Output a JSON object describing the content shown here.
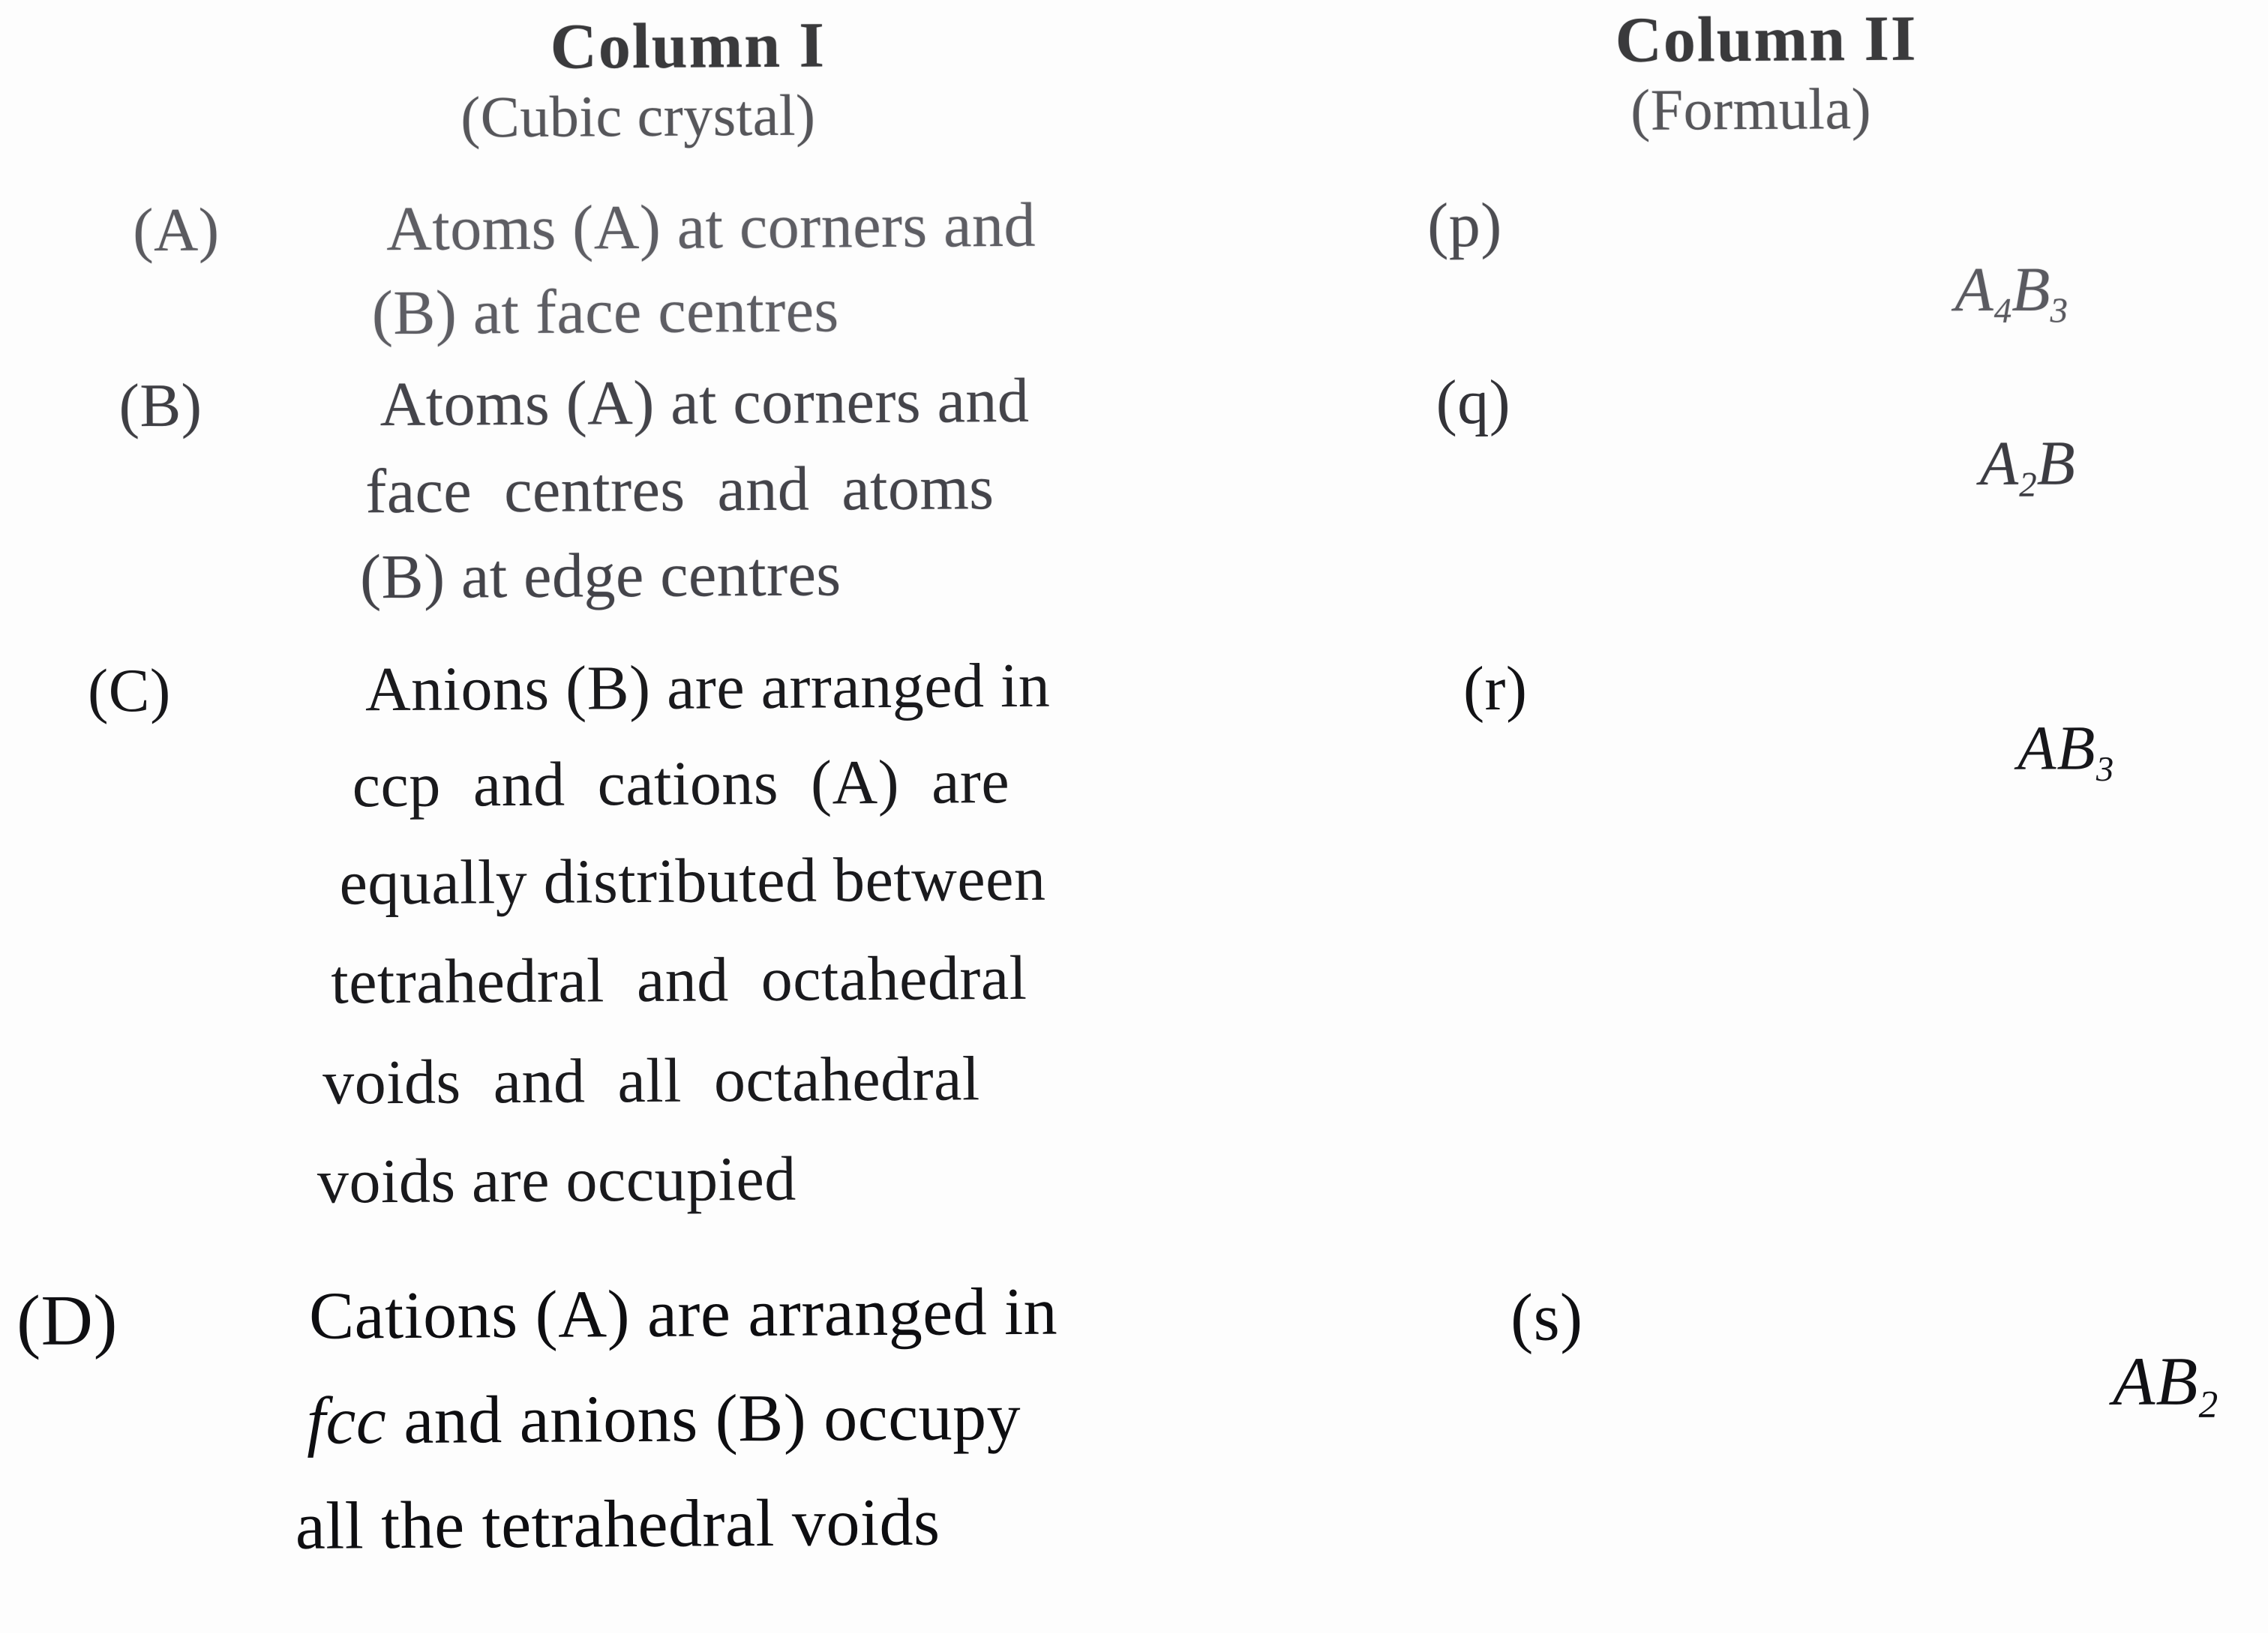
{
  "columns": {
    "left": {
      "title": "Column I",
      "subtitle": "(Cubic crystal)"
    },
    "right": {
      "title": "Column II",
      "subtitle": "(Formula)"
    }
  },
  "rows": [
    {
      "label": "(A)",
      "lines": [
        "Atoms (A) at corners and",
        "(B) at face centres"
      ],
      "marker": "(p)",
      "formula": {
        "text": "A4B3",
        "parts": [
          {
            "t": "A"
          },
          {
            "sub": "4"
          },
          {
            "t": "B"
          },
          {
            "sub": "3"
          }
        ]
      }
    },
    {
      "label": "(B)",
      "lines": [
        "Atoms (A) at corners and",
        "face  centres  and  atoms",
        "(B) at edge centres"
      ],
      "marker": "(q)",
      "formula": {
        "text": "A2B",
        "parts": [
          {
            "t": "A"
          },
          {
            "sub": "2"
          },
          {
            "t": "B"
          }
        ]
      }
    },
    {
      "label": "(C)",
      "lines": [
        "Anions (B) are arranged in",
        "ccp  and  cations  (A)  are",
        "equally distributed between",
        "tetrahedral  and  octahedral",
        "voids  and  all  octahedral",
        "voids are occupied"
      ],
      "marker": "(r)",
      "formula": {
        "text": "AB3",
        "parts": [
          {
            "t": "AB"
          },
          {
            "sub": "3"
          }
        ]
      }
    },
    {
      "label": "(D)",
      "lines": [
        "Cations (A) are arranged in",
        "fcc and anions (B) occupy",
        "all the tetrahedral voids"
      ],
      "line_2_italic_prefix": "fcc",
      "line_2_rest": " and anions (B) occupy",
      "marker": "(s)",
      "formula": {
        "text": "AB2",
        "parts": [
          {
            "t": "AB"
          },
          {
            "sub": "2"
          }
        ]
      }
    }
  ],
  "formulas_display": {
    "p": {
      "base1": "A",
      "sub1": "4",
      "base2": "B",
      "sub2": "3"
    },
    "q": {
      "base1": "A",
      "sub1": "2",
      "base2": "B",
      "sub2": ""
    },
    "r": {
      "base1": "AB",
      "sub1": "3",
      "base2": "",
      "sub2": ""
    },
    "s": {
      "base1": "AB",
      "sub1": "2",
      "base2": "",
      "sub2": ""
    }
  },
  "colors": {
    "ink_faint": "#5b5b60",
    "ink_mid": "#3f3f44",
    "ink_dark": "#17171a",
    "paper": "#fdfdfd"
  }
}
